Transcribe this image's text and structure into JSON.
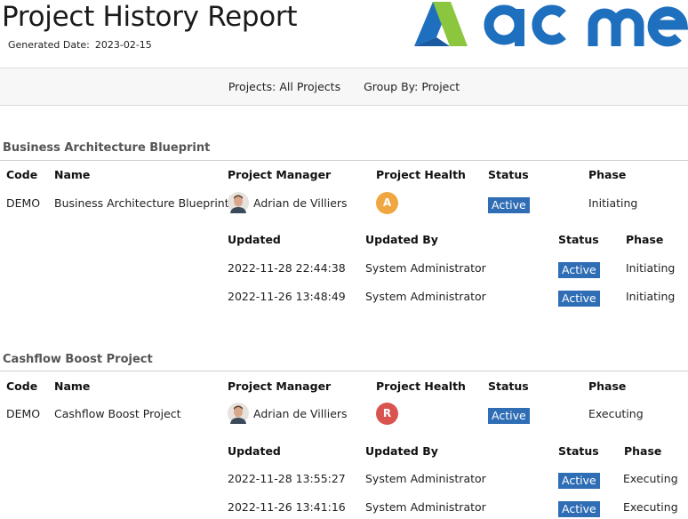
{
  "report": {
    "title": "Project History Report",
    "generated_label": "Generated Date:",
    "generated_value": "2023-02-15"
  },
  "filters": {
    "projects_label": "Projects:",
    "projects_value": "All Projects",
    "groupby_label": "Group By:",
    "groupby_value": "Project"
  },
  "colors": {
    "badge": "#2f6db5",
    "health_amber": "#f0a742",
    "health_red": "#d9534f",
    "logo_blue": "#1f6fbf",
    "logo_green": "#8cc63f"
  },
  "headers": {
    "code": "Code",
    "name": "Name",
    "manager": "Project Manager",
    "health": "Project Health",
    "status": "Status",
    "phase": "Phase",
    "updated": "Updated",
    "updated_by": "Updated By"
  },
  "groups": [
    {
      "title": "Business Architecture Blueprint",
      "code": "DEMO",
      "name": "Business Architecture Blueprint",
      "manager": "Adrian de Villiers",
      "health": "A",
      "status": "Active",
      "phase": "Initiating",
      "history": [
        {
          "updated": "2022-11-28 22:44:38",
          "updated_by": "System Administrator",
          "status": "Active",
          "phase": "Initiating"
        },
        {
          "updated": "2022-11-26 13:48:49",
          "updated_by": "System Administrator",
          "status": "Active",
          "phase": "Initiating"
        }
      ]
    },
    {
      "title": "Cashflow Boost Project",
      "code": "DEMO",
      "name": "Cashflow Boost Project",
      "manager": "Adrian de Villiers",
      "health": "R",
      "status": "Active",
      "phase": "Executing",
      "history": [
        {
          "updated": "2022-11-28 13:55:27",
          "updated_by": "System Administrator",
          "status": "Active",
          "phase": "Executing"
        },
        {
          "updated": "2022-11-26 13:41:16",
          "updated_by": "System Administrator",
          "status": "Active",
          "phase": "Executing"
        }
      ]
    }
  ]
}
